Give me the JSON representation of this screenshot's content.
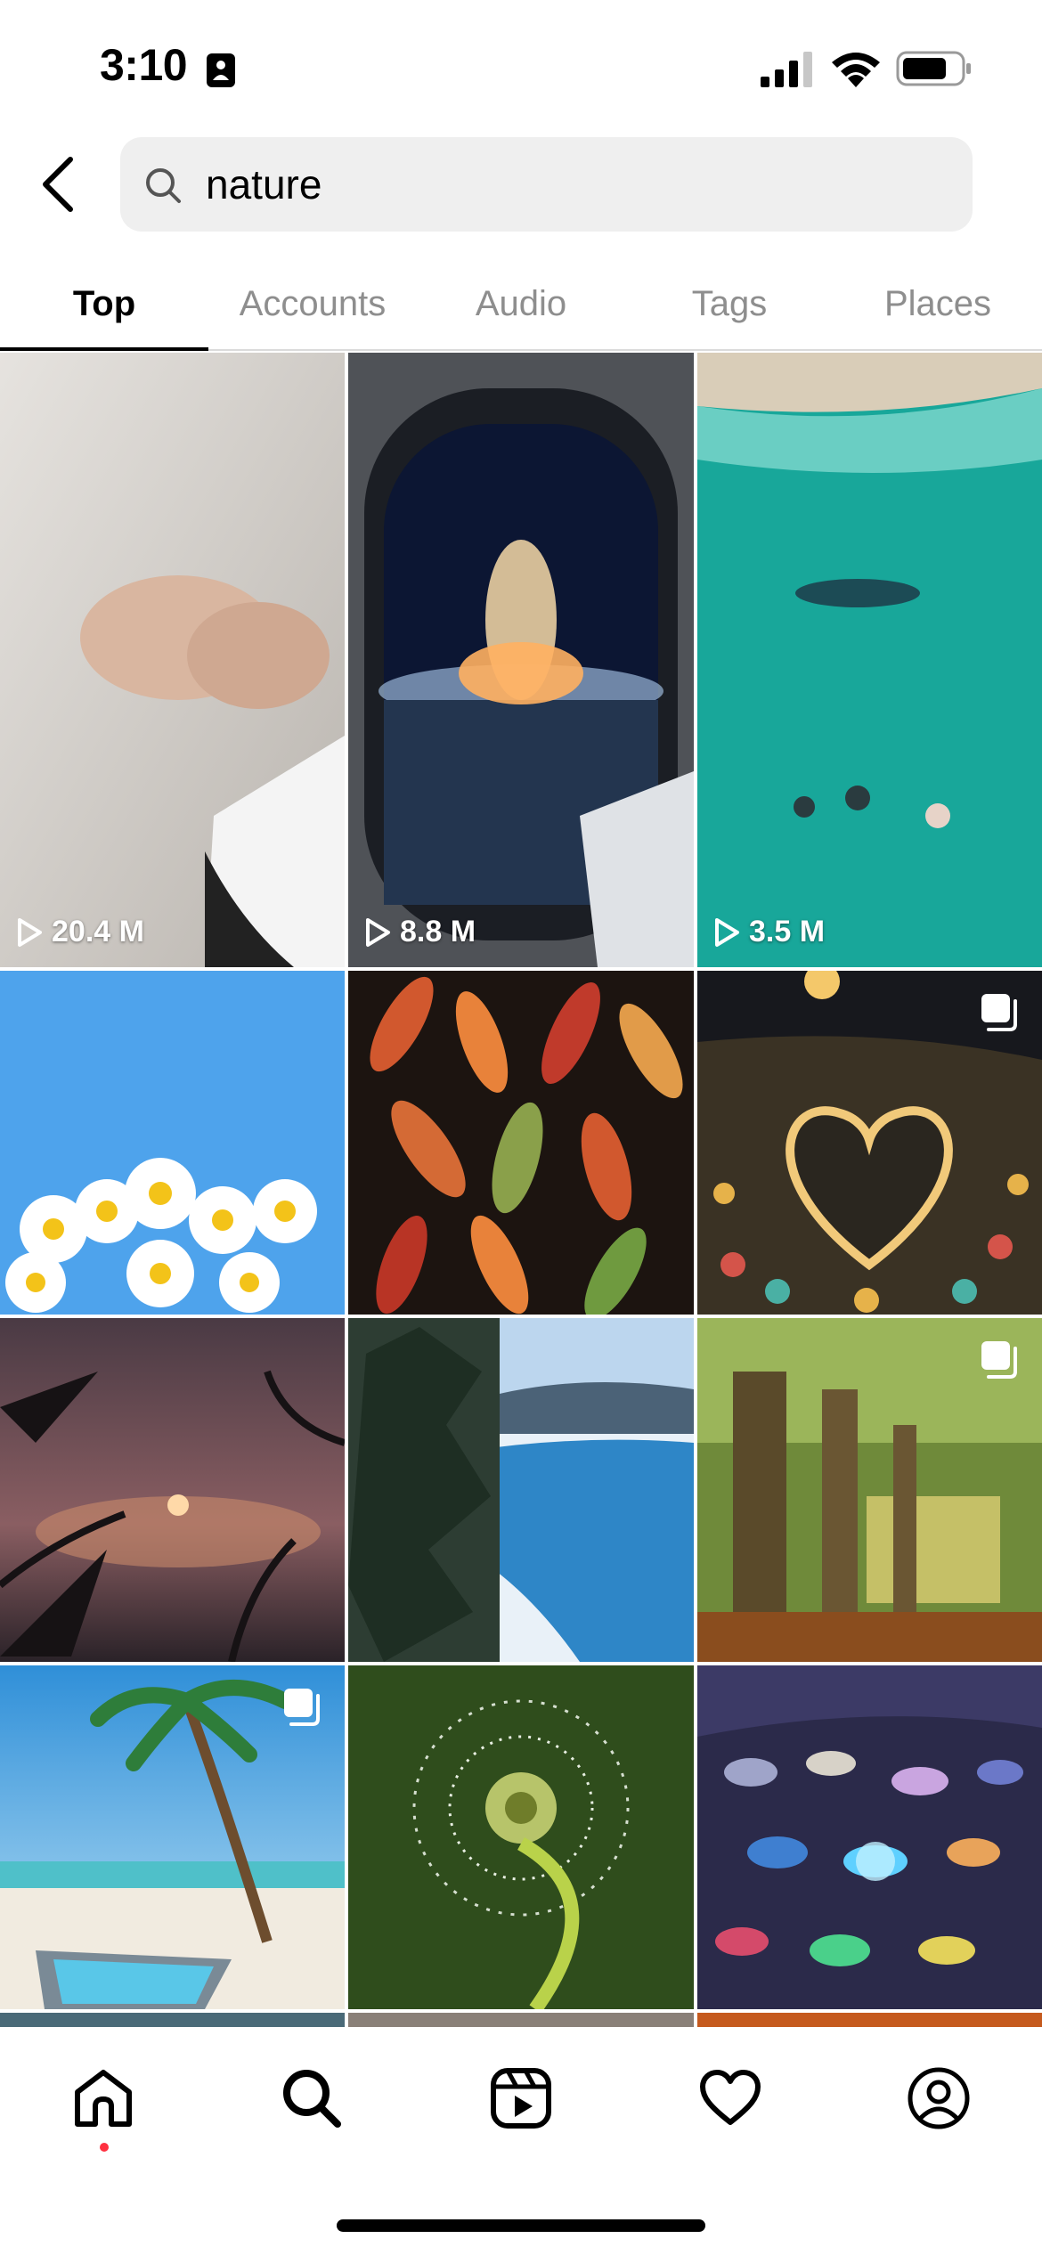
{
  "status_bar": {
    "time": "3:10",
    "icons": [
      "focus-person-icon",
      "cellular-signal-icon",
      "wifi-icon",
      "battery-icon"
    ]
  },
  "search": {
    "back_icon": "chevron-left-icon",
    "query": "nature",
    "icon": "search-icon"
  },
  "tabs": [
    {
      "label": "Top",
      "active": true
    },
    {
      "label": "Accounts",
      "active": false
    },
    {
      "label": "Audio",
      "active": false
    },
    {
      "label": "Tags",
      "active": false
    },
    {
      "label": "Places",
      "active": false
    }
  ],
  "grid": {
    "reels": [
      {
        "views": "20.4 M",
        "icon": "play-icon"
      },
      {
        "views": "8.8 M",
        "icon": "play-icon"
      },
      {
        "views": "3.5 M",
        "icon": "play-icon"
      }
    ],
    "carousel_icon": "multiple-posts-icon"
  },
  "bottom_nav": [
    {
      "icon": "home-icon",
      "active": true
    },
    {
      "icon": "search-icon",
      "active": false
    },
    {
      "icon": "reels-icon",
      "active": false
    },
    {
      "icon": "heart-icon",
      "active": false
    },
    {
      "icon": "profile-icon",
      "active": false
    }
  ],
  "colors": {
    "notification_dot": "#ff3040",
    "search_bg": "#efefef",
    "inactive_tab": "#8e8e8e"
  }
}
